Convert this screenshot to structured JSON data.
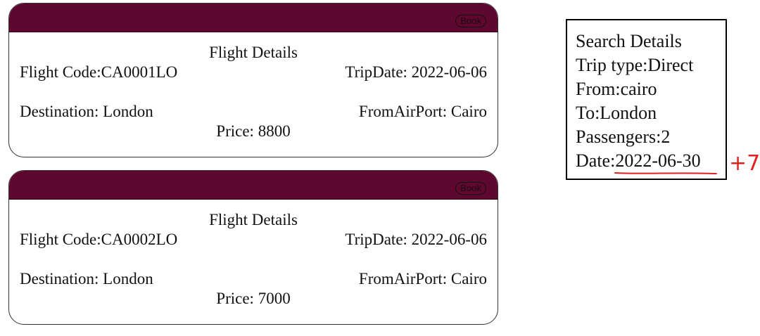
{
  "flights": [
    {
      "book_label": "Book",
      "title": "Flight Details",
      "code": "Flight Code:CA0001LO",
      "trip_date": "TripDate: 2022-06-06",
      "destination": "Destination: London",
      "from_airport": "FromAirPort: Cairo",
      "price": "Price: 8800"
    },
    {
      "book_label": "Book",
      "title": "Flight Details",
      "code": "Flight Code:CA0002LO",
      "trip_date": "TripDate: 2022-06-06",
      "destination": "Destination: London",
      "from_airport": "FromAirPort: Cairo",
      "price": "Price: 7000"
    }
  ],
  "search": {
    "title": "Search Details",
    "trip_type": "Trip type:Direct",
    "from": "From:cairo",
    "to": "To:London",
    "passengers": "Passengers:2",
    "date_label": "Date:",
    "date_value": "2022-06-30"
  },
  "annotation": {
    "note": "+7",
    "color": "#e02020"
  },
  "colors": {
    "header": "#5f082f",
    "text": "#111111"
  }
}
